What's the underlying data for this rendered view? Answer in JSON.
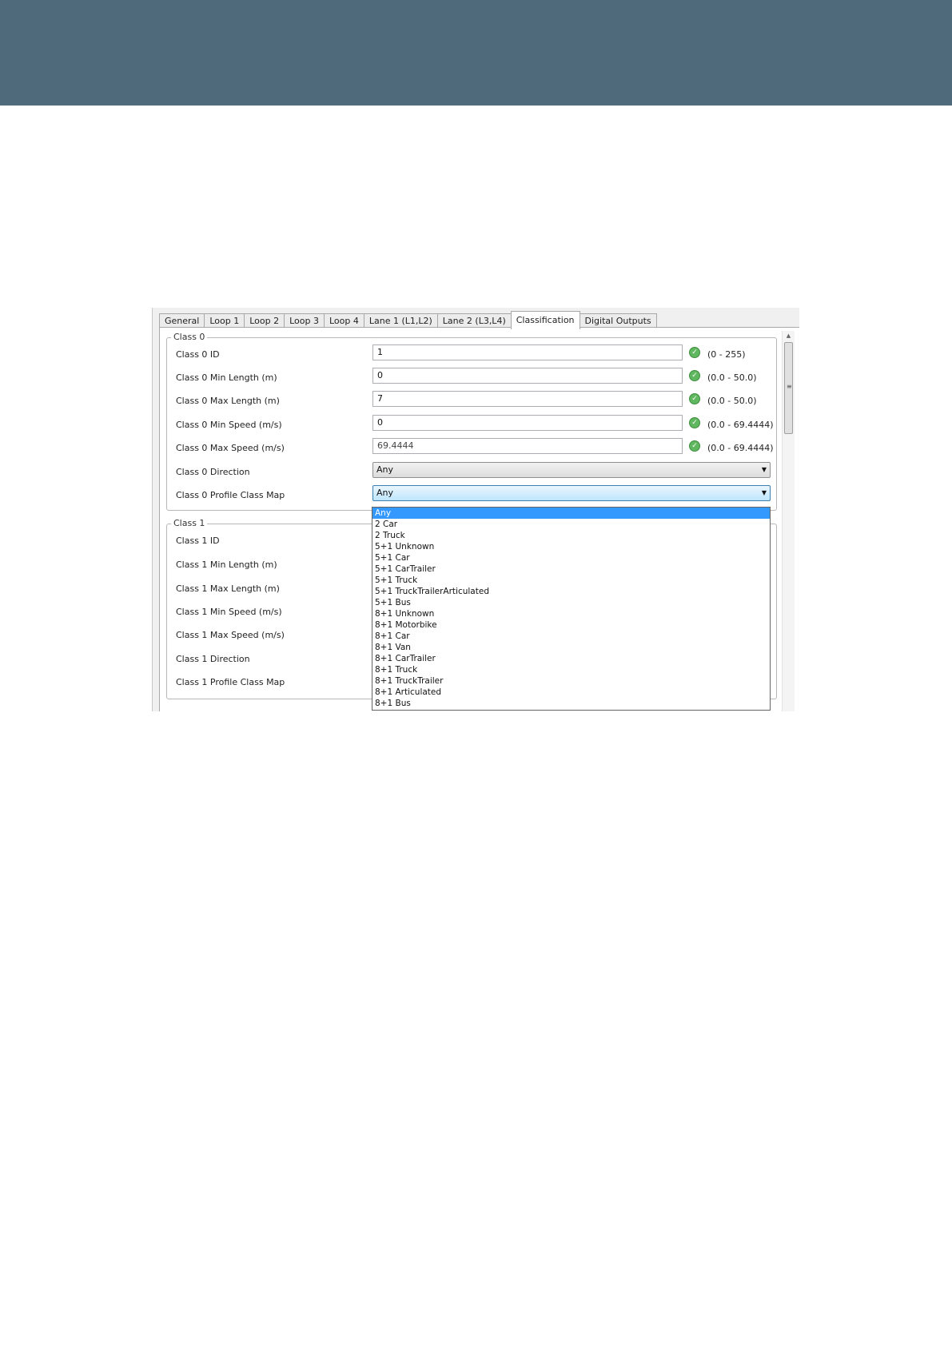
{
  "tabs": [
    "General",
    "Loop 1",
    "Loop 2",
    "Loop 3",
    "Loop 4",
    "Lane 1 (L1,L2)",
    "Lane 2 (L3,L4)",
    "Classification",
    "Digital Outputs"
  ],
  "active_tab": "Classification",
  "class0": {
    "title": "Class 0",
    "fields": [
      {
        "label": "Class 0 ID",
        "value": "1",
        "range": "(0 - 255)"
      },
      {
        "label": "Class 0 Min Length (m)",
        "value": "0",
        "range": "(0.0 - 50.0)"
      },
      {
        "label": "Class 0 Max Length (m)",
        "value": "7",
        "range": "(0.0 - 50.0)"
      },
      {
        "label": "Class 0 Min Speed (m/s)",
        "value": "0",
        "range": "(0.0 - 69.4444)"
      },
      {
        "label": "Class 0 Max Speed (m/s)",
        "value": "69.4444",
        "range": "(0.0 - 69.4444)"
      }
    ],
    "direction_label": "Class 0 Direction",
    "direction_value": "Any",
    "profile_label": "Class 0 Profile Class Map",
    "profile_value": "Any"
  },
  "class1": {
    "title": "Class 1",
    "labels": [
      "Class 1 ID",
      "Class 1 Min Length (m)",
      "Class 1 Max Length (m)",
      "Class 1 Min Speed (m/s)",
      "Class 1 Max Speed (m/s)",
      "Class 1 Direction",
      "Class 1 Profile Class Map"
    ]
  },
  "dropdown_options": [
    "Any",
    "2 Car",
    "2 Truck",
    "5+1 Unknown",
    "5+1 Car",
    "5+1 CarTrailer",
    "5+1 Truck",
    "5+1 TruckTrailerArticulated",
    "5+1 Bus",
    "8+1 Unknown",
    "8+1 Motorbike",
    "8+1 Car",
    "8+1 Van",
    "8+1 CarTrailer",
    "8+1 Truck",
    "8+1 TruckTrailer",
    "8+1 Articulated",
    "8+1 Bus"
  ],
  "dropdown_selected": "Any",
  "icons": {
    "valid": "check-circle-icon",
    "combo_arrow": "chevron-down-icon",
    "scroll_up": "arrow-up-icon",
    "scroll_grip": "grip-icon"
  },
  "colors": {
    "banner": "#4f6a7a",
    "selection": "#3399ff",
    "valid_icon": "#5fb85f"
  }
}
